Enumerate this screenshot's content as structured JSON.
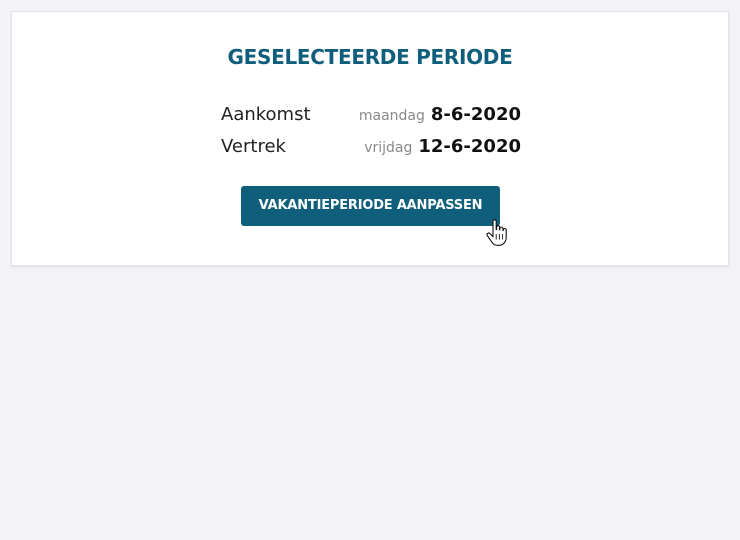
{
  "card": {
    "title": "GESELECTEERDE PERIODE",
    "arrival": {
      "label": "Aankomst",
      "weekday": "maandag",
      "date": "8-6-2020"
    },
    "departure": {
      "label": "Vertrek",
      "weekday": "vrijdag",
      "date": "12-6-2020"
    },
    "button_label": "VAKANTIEPERIODE AANPASSEN"
  },
  "colors": {
    "accent": "#0f5e7b",
    "background": "#f3f3f7"
  },
  "icons": {
    "cursor": "hand-pointer-icon"
  }
}
